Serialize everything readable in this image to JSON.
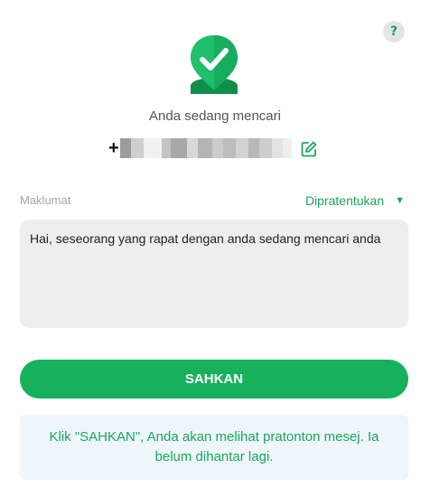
{
  "help": {
    "label": "?"
  },
  "header": {
    "headline": "Anda sedang mencari"
  },
  "phone": {
    "prefix": "+"
  },
  "message": {
    "label": "Maklumat",
    "preset_label": "Dipratentukan",
    "preset_caret": "▼",
    "text": "Hai, seseorang yang rapat dengan anda sedang mencari anda"
  },
  "confirm_button": {
    "label": "SAHKAN"
  },
  "info_note": "Klik \"SAHKAN\", Anda akan melihat pratonton mesej. Ia belum dihantar lagi.",
  "colors": {
    "accent": "#17b15c",
    "accent_text": "#1aa65c",
    "info_bg": "#eef6fb"
  },
  "icons": {
    "logo": "location-check-icon",
    "edit": "edit-icon",
    "help": "help-icon"
  }
}
